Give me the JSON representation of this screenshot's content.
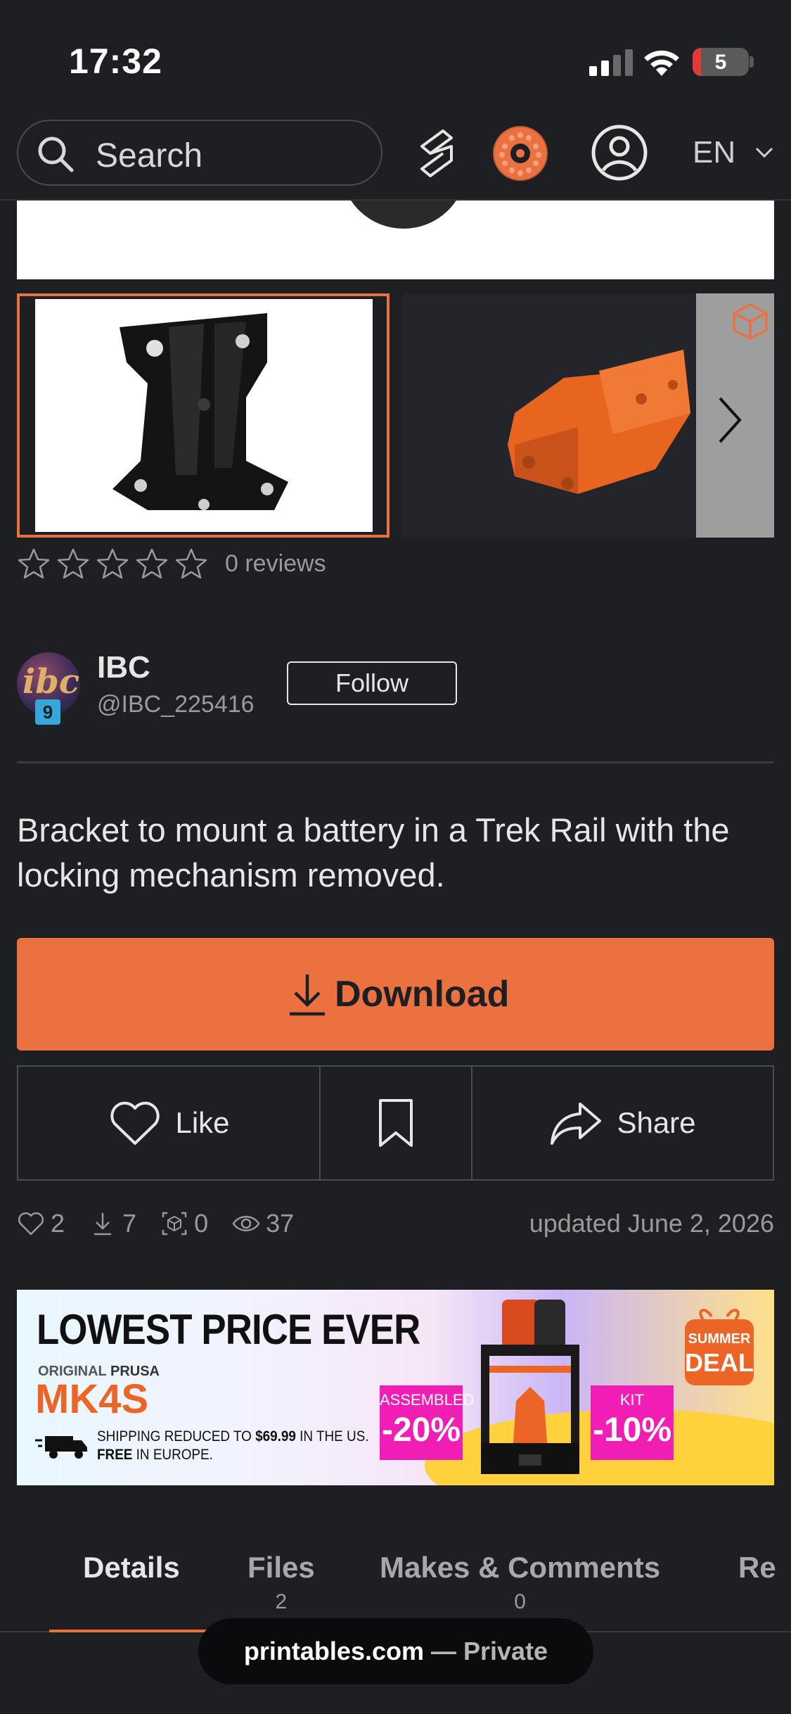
{
  "status_bar": {
    "time": "17:32",
    "battery_level": "5"
  },
  "top_nav": {
    "search_placeholder": "Search",
    "language": "EN",
    "icons": [
      "search-icon",
      "printables-logo-icon",
      "filament-spool-icon",
      "user-account-icon",
      "chevron-down-icon"
    ]
  },
  "gallery": {
    "selected_index": 0,
    "icons": [
      "cube-3d-icon",
      "chevron-right-icon"
    ]
  },
  "rating": {
    "stars": 0,
    "max_stars": 5,
    "reviews_text": "0 reviews"
  },
  "author": {
    "name": "IBC",
    "handle": "@IBC_225416",
    "level_badge": "9",
    "avatar_text": "ibc",
    "follow_label": "Follow"
  },
  "description": "Bracket to mount a battery in a Trek Rail with the locking mechanism removed.",
  "download": {
    "label": "Download"
  },
  "actions": {
    "like_label": "Like",
    "share_label": "Share"
  },
  "stats": {
    "likes": "2",
    "downloads": "7",
    "makes": "0",
    "views": "37",
    "updated": "updated June 2, 2026"
  },
  "ad": {
    "headline": "LOWEST PRICE EVER",
    "original_prefix": "ORIGINAL",
    "brand": "PRUSA",
    "model": "MK4S",
    "shipping_line1_prefix": "SHIPPING REDUCED TO",
    "shipping_price": "$69.99",
    "shipping_line1_suffix": "IN THE US.",
    "shipping_free": "FREE",
    "shipping_line2_suffix": "IN EUROPE.",
    "assembled_label": "ASSEMBLED",
    "assembled_discount": "-20%",
    "kit_label": "KIT",
    "kit_discount": "-10%",
    "summer_line1": "SUMMER",
    "summer_line2": "DEAL"
  },
  "tabs": [
    {
      "label": "Details",
      "count": "",
      "active": true
    },
    {
      "label": "Files",
      "count": "2",
      "active": false
    },
    {
      "label": "Makes & Comments",
      "count": "0",
      "active": false
    },
    {
      "label": "Re",
      "count": "",
      "active": false
    }
  ],
  "url_bar": {
    "domain": "printables.com",
    "separator": " — ",
    "mode": "Private"
  },
  "colors": {
    "accent": "#ec7140",
    "background": "#1e1f23",
    "badge": "#35a7d8",
    "ad_magenta": "#f01eb4"
  }
}
